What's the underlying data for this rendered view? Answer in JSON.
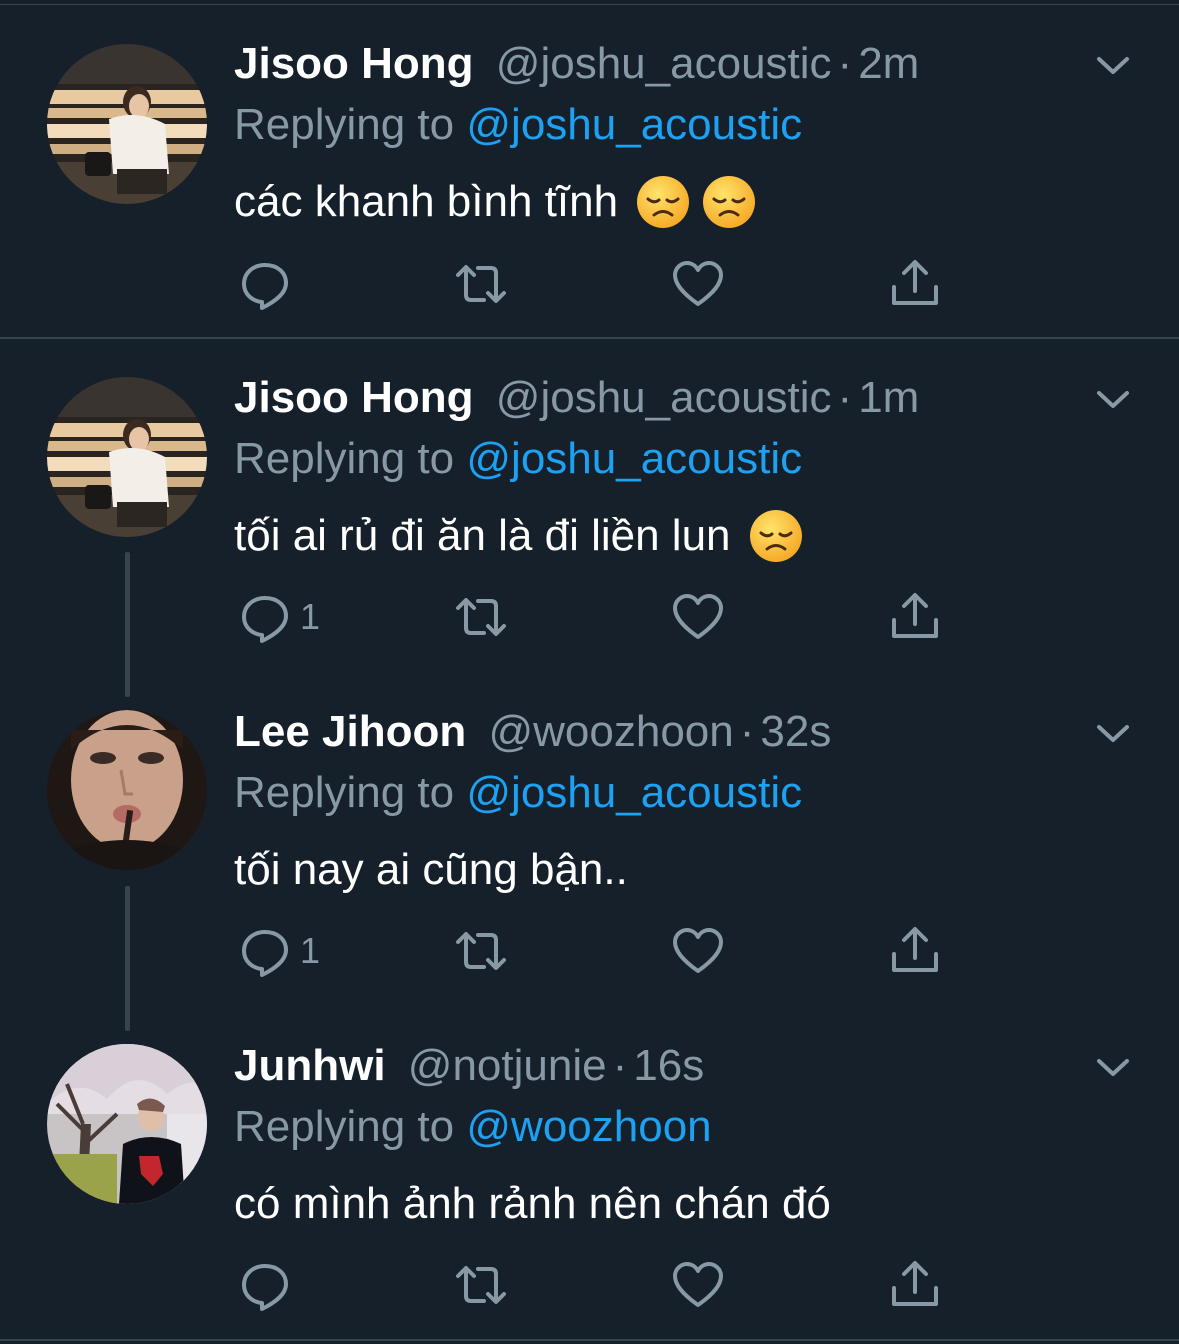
{
  "tweets": [
    {
      "name": "Jisoo Hong",
      "handle": "@joshu_acoustic",
      "time": "2m",
      "replying_prefix": "Replying to",
      "replying_to": "@joshu_acoustic",
      "text": "các khanh bình tĩnh",
      "emoji_count": 2,
      "reply_count": ""
    },
    {
      "name": "Jisoo Hong",
      "handle": "@joshu_acoustic",
      "time": "1m",
      "replying_prefix": "Replying to",
      "replying_to": "@joshu_acoustic",
      "text": "tối ai rủ đi ăn là đi liền lun",
      "emoji_count": 1,
      "reply_count": "1"
    },
    {
      "name": "Lee Jihoon",
      "handle": "@woozhoon",
      "time": "32s",
      "replying_prefix": "Replying to",
      "replying_to": "@joshu_acoustic",
      "text": "tối nay ai cũng bận..",
      "emoji_count": 0,
      "reply_count": "1"
    },
    {
      "name": "Junhwi",
      "handle": "@notjunie",
      "time": "16s",
      "replying_prefix": "Replying to",
      "replying_to": "@woozhoon",
      "text": "có mình ảnh rảnh nên chán đó",
      "emoji_count": 0,
      "reply_count": ""
    }
  ],
  "separator": "·",
  "icons": {
    "reply": "reply-icon",
    "retweet": "retweet-icon",
    "like": "like-icon",
    "share": "share-icon",
    "caret": "chevron-down-icon",
    "emoji": "disappointed-face-emoji"
  },
  "colors": {
    "background": "#15202b",
    "text": "#ffffff",
    "secondary": "#8899a6",
    "accent": "#1da1f2",
    "divider": "#38444d"
  }
}
